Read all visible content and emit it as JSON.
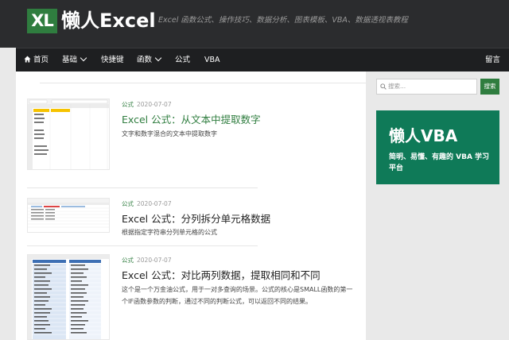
{
  "header": {
    "logo_badge": "XL",
    "logo_text": "懒人Excel",
    "tagline": "Excel 函数公式、操作技巧、数据分析、图表模板、VBA、数据透视表教程"
  },
  "nav": {
    "items": [
      {
        "label": "首页",
        "icon": "home-icon"
      },
      {
        "label": "基础",
        "dropdown": true
      },
      {
        "label": "快捷键"
      },
      {
        "label": "函数",
        "dropdown": true
      },
      {
        "label": "公式"
      },
      {
        "label": "VBA"
      }
    ],
    "right_label": "留言"
  },
  "posts": [
    {
      "category": "公式",
      "date": "2020-07-07",
      "title": "Excel 公式：从文本中提取数字",
      "excerpt": "文字和数字混合的文本中提取数字",
      "active": true
    },
    {
      "category": "公式",
      "date": "2020-07-07",
      "title": "Excel 公式：分列拆分单元格数据",
      "excerpt": "根据指定字符串分列单元格的公式",
      "active": false
    },
    {
      "category": "公式",
      "date": "2020-07-07",
      "title": "Excel 公式：对比两列数据，提取相同和不同",
      "excerpt": "这个是一个万金油公式，用于一对多查询的场景。公式的核心是SMALL函数的第一个IF函数参数的判断，通过不同的判断公式，可以返回不同的结果。",
      "active": false
    }
  ],
  "thumb1": {
    "header_cells": [
      "混合数字的文本",
      "提取的数字"
    ],
    "values": [
      "ABC123",
      "ABC-123",
      "ABC123",
      "",
      "123ABC",
      "123-ABC",
      "123 ABC",
      "",
      "ABC123DEF",
      "ABC-123-DEF",
      "ABC123DEF"
    ]
  },
  "sidebar": {
    "search_placeholder": "搜索...",
    "search_button": "搜索",
    "ad_title": "懒人VBA",
    "ad_subtitle": "简明、易懂、有趣的 VBA 学习平台"
  },
  "colors": {
    "brand_green": "#2f7d3f",
    "header_bg": "#2b2c2e",
    "nav_bg": "#1e1f21",
    "ad_bg": "#0f7a58"
  }
}
